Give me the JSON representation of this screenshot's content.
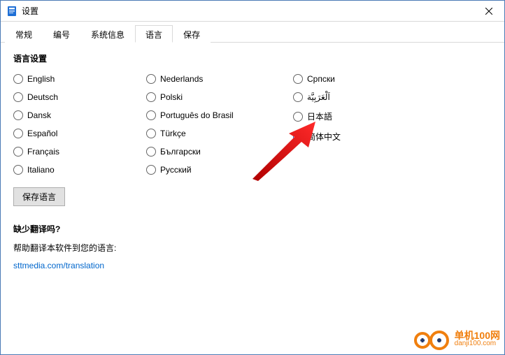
{
  "window": {
    "title": "设置"
  },
  "tabs": [
    {
      "id": "general",
      "label": "常规",
      "active": false
    },
    {
      "id": "numbering",
      "label": "编号",
      "active": false
    },
    {
      "id": "sysinfo",
      "label": "系统信息",
      "active": false
    },
    {
      "id": "language",
      "label": "语言",
      "active": true
    },
    {
      "id": "save",
      "label": "保存",
      "active": false
    }
  ],
  "section": {
    "title": "语言设置"
  },
  "languages": {
    "col1": [
      {
        "label": "English",
        "checked": false
      },
      {
        "label": "Deutsch",
        "checked": false
      },
      {
        "label": "Dansk",
        "checked": false
      },
      {
        "label": "Español",
        "checked": false
      },
      {
        "label": "Français",
        "checked": false
      },
      {
        "label": "Italiano",
        "checked": false
      }
    ],
    "col2": [
      {
        "label": "Nederlands",
        "checked": false
      },
      {
        "label": "Polski",
        "checked": false
      },
      {
        "label": "Português do Brasil",
        "checked": false
      },
      {
        "label": "Türkçe",
        "checked": false
      },
      {
        "label": "Български",
        "checked": false
      },
      {
        "label": "Русский",
        "checked": false
      }
    ],
    "col3": [
      {
        "label": "Српски",
        "checked": false
      },
      {
        "label": "اَلْعَرَبِيَّة",
        "checked": false
      },
      {
        "label": "日本語",
        "checked": false
      },
      {
        "label": "简体中文",
        "checked": true
      }
    ]
  },
  "buttons": {
    "save_lang": "保存语言"
  },
  "missing": {
    "title": "缺少翻译吗?",
    "help": "帮助翻译本软件到您的语言:",
    "link": "sttmedia.com/translation"
  },
  "watermark": {
    "cn": "单机100网",
    "url": "danji100.com"
  }
}
